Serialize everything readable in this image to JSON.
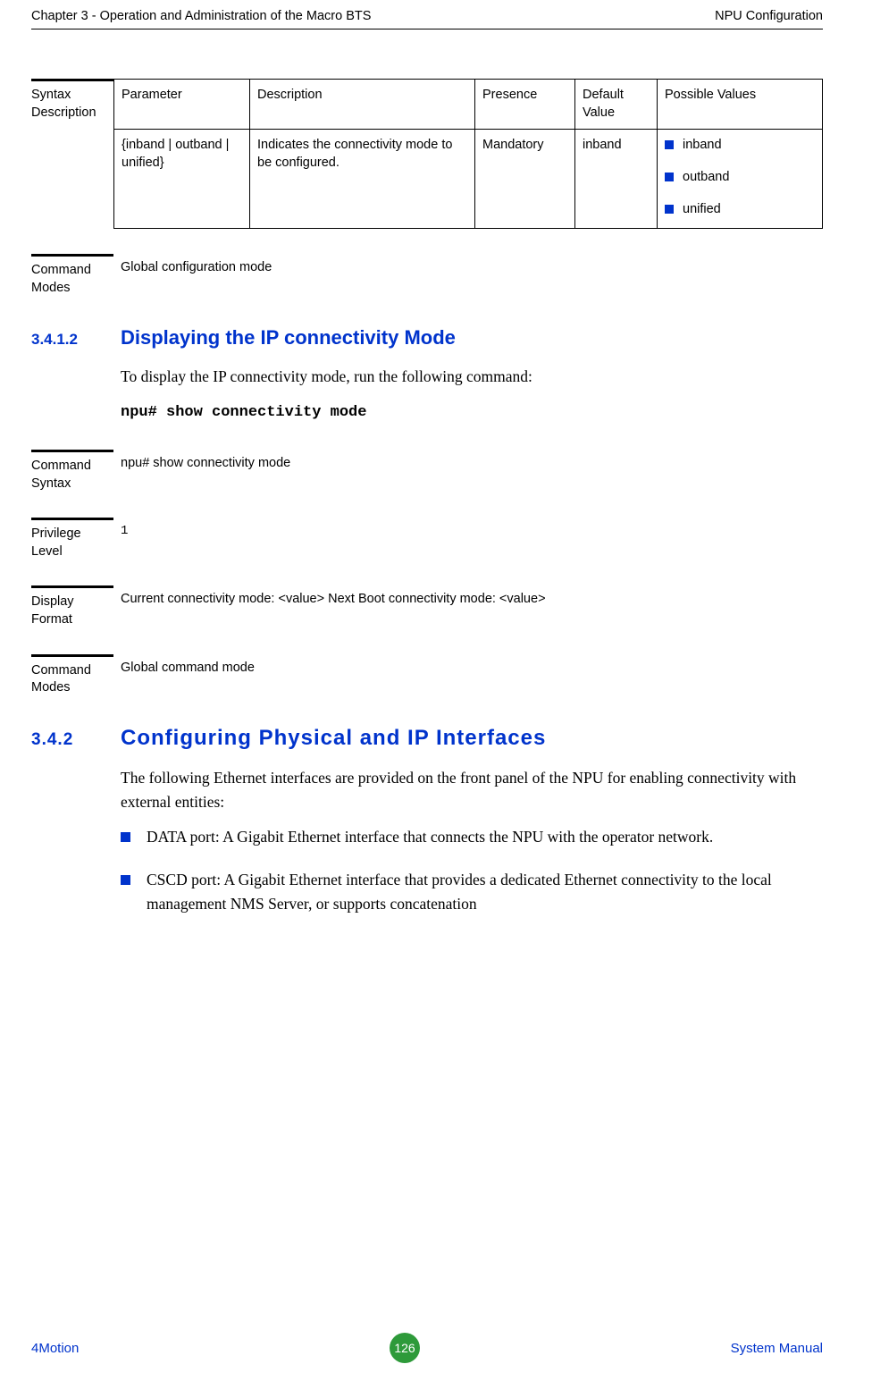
{
  "header": {
    "left": "Chapter 3 - Operation and Administration of the Macro BTS",
    "right": "NPU Configuration"
  },
  "syntax_description": {
    "label": "Syntax Description",
    "columns": {
      "parameter": "Parameter",
      "description": "Description",
      "presence": "Presence",
      "default_value": "Default Value",
      "possible_values": "Possible Values"
    },
    "row": {
      "parameter": "{inband | outband | unified}",
      "description": "Indicates the connectivity mode to be configured.",
      "presence": "Mandatory",
      "default_value": "inband",
      "possible_values": [
        "inband",
        "outband",
        "unified"
      ]
    }
  },
  "command_modes_1": {
    "label": "Command Modes",
    "value": "Global configuration mode"
  },
  "section_3_4_1_2": {
    "number": "3.4.1.2",
    "title": "Displaying the IP connectivity Mode",
    "intro": "To display the IP connectivity mode, run the following command:",
    "command": "npu# show connectivity mode"
  },
  "command_syntax": {
    "label": "Command Syntax",
    "value": "npu# show connectivity mode"
  },
  "privilege_level": {
    "label": "Privilege Level",
    "value": "1"
  },
  "display_format": {
    "label": "Display Format",
    "value": "Current connectivity mode: <value> Next Boot connectivity mode: <value>"
  },
  "command_modes_2": {
    "label": "Command Modes",
    "value": "Global command mode"
  },
  "section_3_4_2": {
    "number": "3.4.2",
    "title": "Configuring Physical and IP Interfaces",
    "intro": "The following Ethernet interfaces are provided on the front panel of the NPU for enabling connectivity with external entities:",
    "bullets": [
      "DATA port: A Gigabit Ethernet interface that connects the NPU with the operator network.",
      "CSCD port: A Gigabit Ethernet interface that provides a dedicated Ethernet connectivity to the local management NMS Server, or supports concatenation"
    ]
  },
  "footer": {
    "left": "4Motion",
    "page": "126",
    "right": "System Manual"
  }
}
